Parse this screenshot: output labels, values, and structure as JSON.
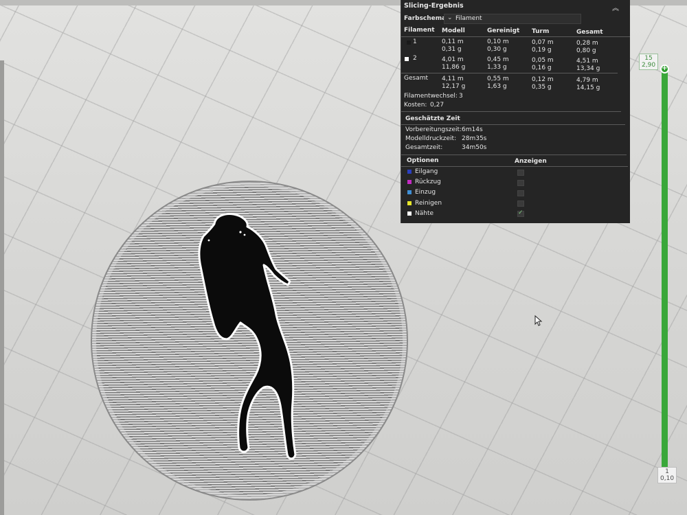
{
  "panel": {
    "title": "Slicing-Ergebnis",
    "color_scheme_label": "Farbschema",
    "color_scheme_value": "Filament",
    "table": {
      "headers": [
        "Filament",
        "Modell",
        "Gereinigt",
        "Turm",
        "Gesamt"
      ],
      "rows": [
        {
          "filament": "1",
          "swatch": "#1a1a1a",
          "modell": [
            "0,11 m",
            "0,31 g"
          ],
          "gereinigt": [
            "0,10 m",
            "0,30 g"
          ],
          "turm": [
            "0,07 m",
            "0,19 g"
          ],
          "gesamt": [
            "0,28 m",
            "0,80 g"
          ]
        },
        {
          "filament": "2",
          "swatch": "#ffffff",
          "modell": [
            "4,01 m",
            "11,86 g"
          ],
          "gereinigt": [
            "0,45 m",
            "1,33 g"
          ],
          "turm": [
            "0,05 m",
            "0,16 g"
          ],
          "gesamt": [
            "4,51 m",
            "13,34 g"
          ]
        }
      ],
      "total": {
        "label": "Gesamt",
        "modell": [
          "4,11 m",
          "12,17 g"
        ],
        "gereinigt": [
          "0,55 m",
          "1,63 g"
        ],
        "turm": [
          "0,12 m",
          "0,35 g"
        ],
        "gesamt": [
          "4,79 m",
          "14,15 g"
        ]
      }
    },
    "filament_changes_label": "Filamentwechsel:",
    "filament_changes_value": "3",
    "cost_label": "Kosten:",
    "cost_value": "0,27",
    "time_section_title": "Geschätzte Zeit",
    "prep_time_label": "Vorbereitungszeit:",
    "prep_time_value": "6m14s",
    "print_time_label": "Modelldruckzeit:",
    "print_time_value": "28m35s",
    "total_time_label": "Gesamtzeit:",
    "total_time_value": "34m50s",
    "options_header": "Optionen",
    "show_header": "Anzeigen",
    "options": [
      {
        "label": "Eilgang",
        "color": "#2b3fbf",
        "checked": false
      },
      {
        "label": "Rückzug",
        "color": "#c42bc4",
        "checked": false
      },
      {
        "label": "Einzug",
        "color": "#3f8fd6",
        "checked": false
      },
      {
        "label": "Reinigen",
        "color": "#e6e62b",
        "checked": false
      },
      {
        "label": "Nähte",
        "color": "#ffffff",
        "checked": true
      }
    ]
  },
  "slider": {
    "top_layer": "15",
    "top_height": "2,90",
    "bottom_layer": "1",
    "bottom_height": "0,10"
  },
  "colors": {
    "panel_bg": "#252525",
    "slider_green": "#3aa73a"
  }
}
